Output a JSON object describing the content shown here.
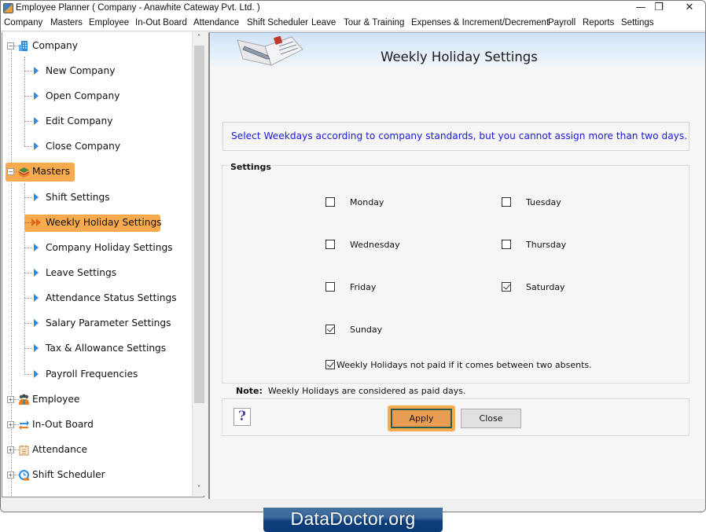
{
  "window": {
    "title": "Employee Planner ( Company - Anawhite Cateway Pvt. Ltd. )",
    "controls": {
      "minimize": "—",
      "maximize": "❐",
      "close": "✕"
    }
  },
  "menu": [
    "Company",
    "Masters",
    "Employee",
    "In-Out Board",
    "Attendance",
    "Shift Scheduler",
    "Leave",
    "Tour & Training",
    "Expenses & Increment/Decrement",
    "Payroll",
    "Reports",
    "Settings"
  ],
  "sidebar": {
    "nodes": [
      {
        "label": "Company",
        "icon": "building-icon",
        "expanded": true,
        "children": [
          "New Company",
          "Open Company",
          "Edit Company",
          "Close Company"
        ]
      },
      {
        "label": "Masters",
        "icon": "layers-icon",
        "expanded": true,
        "selected": true,
        "children": [
          "Shift Settings",
          "Weekly Holiday Settings",
          "Company Holiday Settings",
          "Leave Settings",
          "Attendance Status Settings",
          "Salary Parameter Settings",
          "Tax & Allowance Settings",
          "Payroll Frequencies"
        ],
        "selected_child": "Weekly Holiday Settings"
      },
      {
        "label": "Employee",
        "icon": "people-icon",
        "expanded": false
      },
      {
        "label": "In-Out Board",
        "icon": "swap-arrows-icon",
        "expanded": false
      },
      {
        "label": "Attendance",
        "icon": "calendar-icon",
        "expanded": false
      },
      {
        "label": "Shift Scheduler",
        "icon": "clock-icon",
        "expanded": false
      }
    ]
  },
  "main": {
    "title": "Weekly Holiday Settings",
    "info": "Select Weekdays according to company standards, but you cannot assign more than two days.",
    "settings_label": "Settings",
    "days": [
      {
        "label": "Monday",
        "checked": false
      },
      {
        "label": "Tuesday",
        "checked": false
      },
      {
        "label": "Wednesday",
        "checked": false
      },
      {
        "label": "Thursday",
        "checked": false
      },
      {
        "label": "Friday",
        "checked": false
      },
      {
        "label": "Saturday",
        "checked": true
      },
      {
        "label": "Sunday",
        "checked": true
      }
    ],
    "not_paid_option": {
      "label": "Weekly Holidays not paid if it comes between two absents.",
      "checked": true
    },
    "note_prefix": "Note:",
    "note_text": "Weekly Holidays are considered as paid days.",
    "help_label": "?",
    "apply_label": "Apply",
    "close_label": "Close"
  },
  "watermark": "DataDoctor.org",
  "colors": {
    "selection": "#f7aa4e",
    "info_text": "#1a1ae0",
    "tree_arrow": "#2a8de0",
    "apply_bg": "#e99d53"
  }
}
